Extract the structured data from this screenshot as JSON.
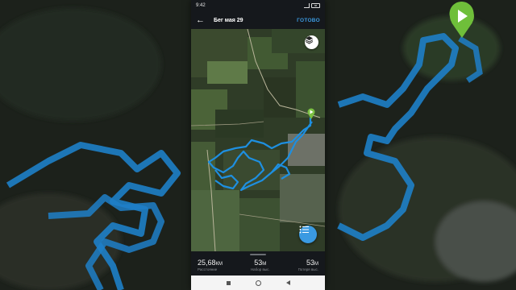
{
  "status": {
    "time": "9:42",
    "battery": "88"
  },
  "header": {
    "title": "Бег мая 29",
    "done_label": "ГОТОВО"
  },
  "icons": {
    "back": "arrow-left-icon",
    "layers": "layers-icon",
    "list": "list-icon",
    "start_flag": "play-flag-icon"
  },
  "stats": [
    {
      "value": "25,68",
      "unit": "КМ",
      "label": "Расстояние"
    },
    {
      "value": "53",
      "unit": "М",
      "label": "Набор выс."
    },
    {
      "value": "53",
      "unit": "М",
      "label": "Потеря выс."
    }
  ],
  "colors": {
    "route": "#1e8fe0",
    "accent": "#3b9ae0",
    "start_marker": "#7bc142"
  }
}
